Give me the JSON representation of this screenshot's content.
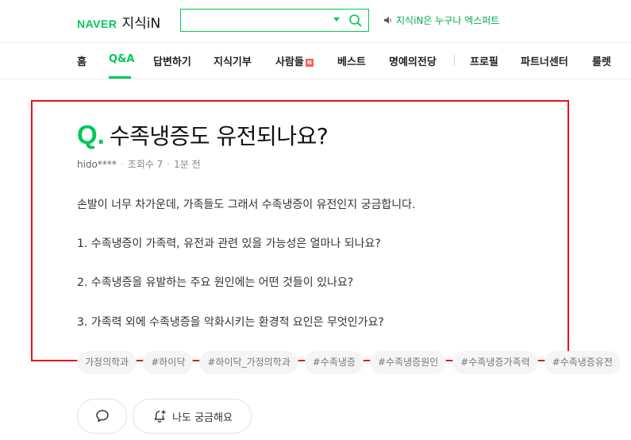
{
  "header": {
    "logo_brand": "NAVER",
    "logo_service": "지식iN",
    "search_value": "",
    "promo_text": "지식iN은 누구나 엑스퍼트"
  },
  "nav": {
    "items": [
      {
        "label": "홈"
      },
      {
        "label": "Q&A"
      },
      {
        "label": "답변하기"
      },
      {
        "label": "지식기부"
      },
      {
        "label": "사람들"
      },
      {
        "label": "베스트"
      },
      {
        "label": "명예의전당"
      },
      {
        "label": "프로필"
      },
      {
        "label": "파트너센터"
      },
      {
        "label": "룰렛"
      }
    ],
    "active": "Q&A",
    "new_badge": "N"
  },
  "question": {
    "mark": "Q.",
    "title": "수족냉증도 유전되나요?",
    "author": "hido****",
    "views": "조회수 7",
    "time": "1분 전",
    "body": [
      "손발이 너무 차가운데, 가족들도 그래서 수족냉증이 유전인지 궁금합니다.",
      "1. 수족냉증이 가족력, 유전과 관련 있을 가능성은 얼마나 되나요?",
      "2. 수족냉증을 유발하는 주요 원인에는 어떤 것들이 있나요?",
      "3. 가족력 외에 수족냉증을 악화시키는 환경적 요인은 무엇인가요?"
    ],
    "tags": [
      "가정의학과",
      "#하이닥",
      "#하이닥_가정의학과",
      "#수족냉증",
      "#수족냉증원인",
      "#수족냉증가족력",
      "#수족냉증유전"
    ]
  },
  "actions": {
    "curious_label": "나도 궁금해요"
  },
  "colors": {
    "brand_green": "#03c75a",
    "highlight_red": "#e8101a"
  }
}
